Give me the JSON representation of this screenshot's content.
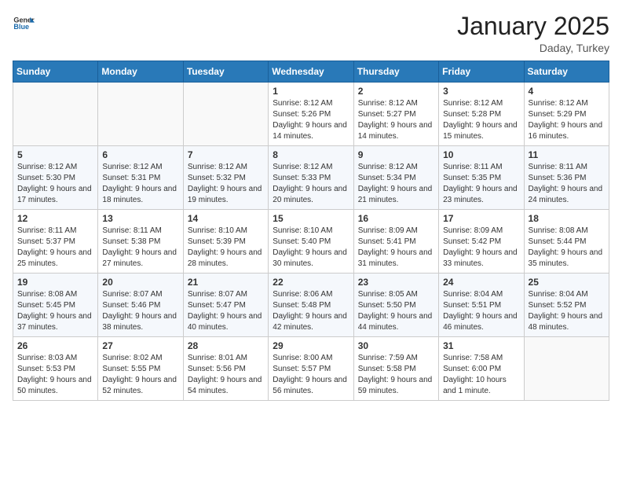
{
  "logo": {
    "general": "General",
    "blue": "Blue"
  },
  "header": {
    "month": "January 2025",
    "location": "Daday, Turkey"
  },
  "weekdays": [
    "Sunday",
    "Monday",
    "Tuesday",
    "Wednesday",
    "Thursday",
    "Friday",
    "Saturday"
  ],
  "weeks": [
    [
      {
        "day": "",
        "sunrise": "",
        "sunset": "",
        "daylight": ""
      },
      {
        "day": "",
        "sunrise": "",
        "sunset": "",
        "daylight": ""
      },
      {
        "day": "",
        "sunrise": "",
        "sunset": "",
        "daylight": ""
      },
      {
        "day": "1",
        "sunrise": "Sunrise: 8:12 AM",
        "sunset": "Sunset: 5:26 PM",
        "daylight": "Daylight: 9 hours and 14 minutes."
      },
      {
        "day": "2",
        "sunrise": "Sunrise: 8:12 AM",
        "sunset": "Sunset: 5:27 PM",
        "daylight": "Daylight: 9 hours and 14 minutes."
      },
      {
        "day": "3",
        "sunrise": "Sunrise: 8:12 AM",
        "sunset": "Sunset: 5:28 PM",
        "daylight": "Daylight: 9 hours and 15 minutes."
      },
      {
        "day": "4",
        "sunrise": "Sunrise: 8:12 AM",
        "sunset": "Sunset: 5:29 PM",
        "daylight": "Daylight: 9 hours and 16 minutes."
      }
    ],
    [
      {
        "day": "5",
        "sunrise": "Sunrise: 8:12 AM",
        "sunset": "Sunset: 5:30 PM",
        "daylight": "Daylight: 9 hours and 17 minutes."
      },
      {
        "day": "6",
        "sunrise": "Sunrise: 8:12 AM",
        "sunset": "Sunset: 5:31 PM",
        "daylight": "Daylight: 9 hours and 18 minutes."
      },
      {
        "day": "7",
        "sunrise": "Sunrise: 8:12 AM",
        "sunset": "Sunset: 5:32 PM",
        "daylight": "Daylight: 9 hours and 19 minutes."
      },
      {
        "day": "8",
        "sunrise": "Sunrise: 8:12 AM",
        "sunset": "Sunset: 5:33 PM",
        "daylight": "Daylight: 9 hours and 20 minutes."
      },
      {
        "day": "9",
        "sunrise": "Sunrise: 8:12 AM",
        "sunset": "Sunset: 5:34 PM",
        "daylight": "Daylight: 9 hours and 21 minutes."
      },
      {
        "day": "10",
        "sunrise": "Sunrise: 8:11 AM",
        "sunset": "Sunset: 5:35 PM",
        "daylight": "Daylight: 9 hours and 23 minutes."
      },
      {
        "day": "11",
        "sunrise": "Sunrise: 8:11 AM",
        "sunset": "Sunset: 5:36 PM",
        "daylight": "Daylight: 9 hours and 24 minutes."
      }
    ],
    [
      {
        "day": "12",
        "sunrise": "Sunrise: 8:11 AM",
        "sunset": "Sunset: 5:37 PM",
        "daylight": "Daylight: 9 hours and 25 minutes."
      },
      {
        "day": "13",
        "sunrise": "Sunrise: 8:11 AM",
        "sunset": "Sunset: 5:38 PM",
        "daylight": "Daylight: 9 hours and 27 minutes."
      },
      {
        "day": "14",
        "sunrise": "Sunrise: 8:10 AM",
        "sunset": "Sunset: 5:39 PM",
        "daylight": "Daylight: 9 hours and 28 minutes."
      },
      {
        "day": "15",
        "sunrise": "Sunrise: 8:10 AM",
        "sunset": "Sunset: 5:40 PM",
        "daylight": "Daylight: 9 hours and 30 minutes."
      },
      {
        "day": "16",
        "sunrise": "Sunrise: 8:09 AM",
        "sunset": "Sunset: 5:41 PM",
        "daylight": "Daylight: 9 hours and 31 minutes."
      },
      {
        "day": "17",
        "sunrise": "Sunrise: 8:09 AM",
        "sunset": "Sunset: 5:42 PM",
        "daylight": "Daylight: 9 hours and 33 minutes."
      },
      {
        "day": "18",
        "sunrise": "Sunrise: 8:08 AM",
        "sunset": "Sunset: 5:44 PM",
        "daylight": "Daylight: 9 hours and 35 minutes."
      }
    ],
    [
      {
        "day": "19",
        "sunrise": "Sunrise: 8:08 AM",
        "sunset": "Sunset: 5:45 PM",
        "daylight": "Daylight: 9 hours and 37 minutes."
      },
      {
        "day": "20",
        "sunrise": "Sunrise: 8:07 AM",
        "sunset": "Sunset: 5:46 PM",
        "daylight": "Daylight: 9 hours and 38 minutes."
      },
      {
        "day": "21",
        "sunrise": "Sunrise: 8:07 AM",
        "sunset": "Sunset: 5:47 PM",
        "daylight": "Daylight: 9 hours and 40 minutes."
      },
      {
        "day": "22",
        "sunrise": "Sunrise: 8:06 AM",
        "sunset": "Sunset: 5:48 PM",
        "daylight": "Daylight: 9 hours and 42 minutes."
      },
      {
        "day": "23",
        "sunrise": "Sunrise: 8:05 AM",
        "sunset": "Sunset: 5:50 PM",
        "daylight": "Daylight: 9 hours and 44 minutes."
      },
      {
        "day": "24",
        "sunrise": "Sunrise: 8:04 AM",
        "sunset": "Sunset: 5:51 PM",
        "daylight": "Daylight: 9 hours and 46 minutes."
      },
      {
        "day": "25",
        "sunrise": "Sunrise: 8:04 AM",
        "sunset": "Sunset: 5:52 PM",
        "daylight": "Daylight: 9 hours and 48 minutes."
      }
    ],
    [
      {
        "day": "26",
        "sunrise": "Sunrise: 8:03 AM",
        "sunset": "Sunset: 5:53 PM",
        "daylight": "Daylight: 9 hours and 50 minutes."
      },
      {
        "day": "27",
        "sunrise": "Sunrise: 8:02 AM",
        "sunset": "Sunset: 5:55 PM",
        "daylight": "Daylight: 9 hours and 52 minutes."
      },
      {
        "day": "28",
        "sunrise": "Sunrise: 8:01 AM",
        "sunset": "Sunset: 5:56 PM",
        "daylight": "Daylight: 9 hours and 54 minutes."
      },
      {
        "day": "29",
        "sunrise": "Sunrise: 8:00 AM",
        "sunset": "Sunset: 5:57 PM",
        "daylight": "Daylight: 9 hours and 56 minutes."
      },
      {
        "day": "30",
        "sunrise": "Sunrise: 7:59 AM",
        "sunset": "Sunset: 5:58 PM",
        "daylight": "Daylight: 9 hours and 59 minutes."
      },
      {
        "day": "31",
        "sunrise": "Sunrise: 7:58 AM",
        "sunset": "Sunset: 6:00 PM",
        "daylight": "Daylight: 10 hours and 1 minute."
      },
      {
        "day": "",
        "sunrise": "",
        "sunset": "",
        "daylight": ""
      }
    ]
  ]
}
